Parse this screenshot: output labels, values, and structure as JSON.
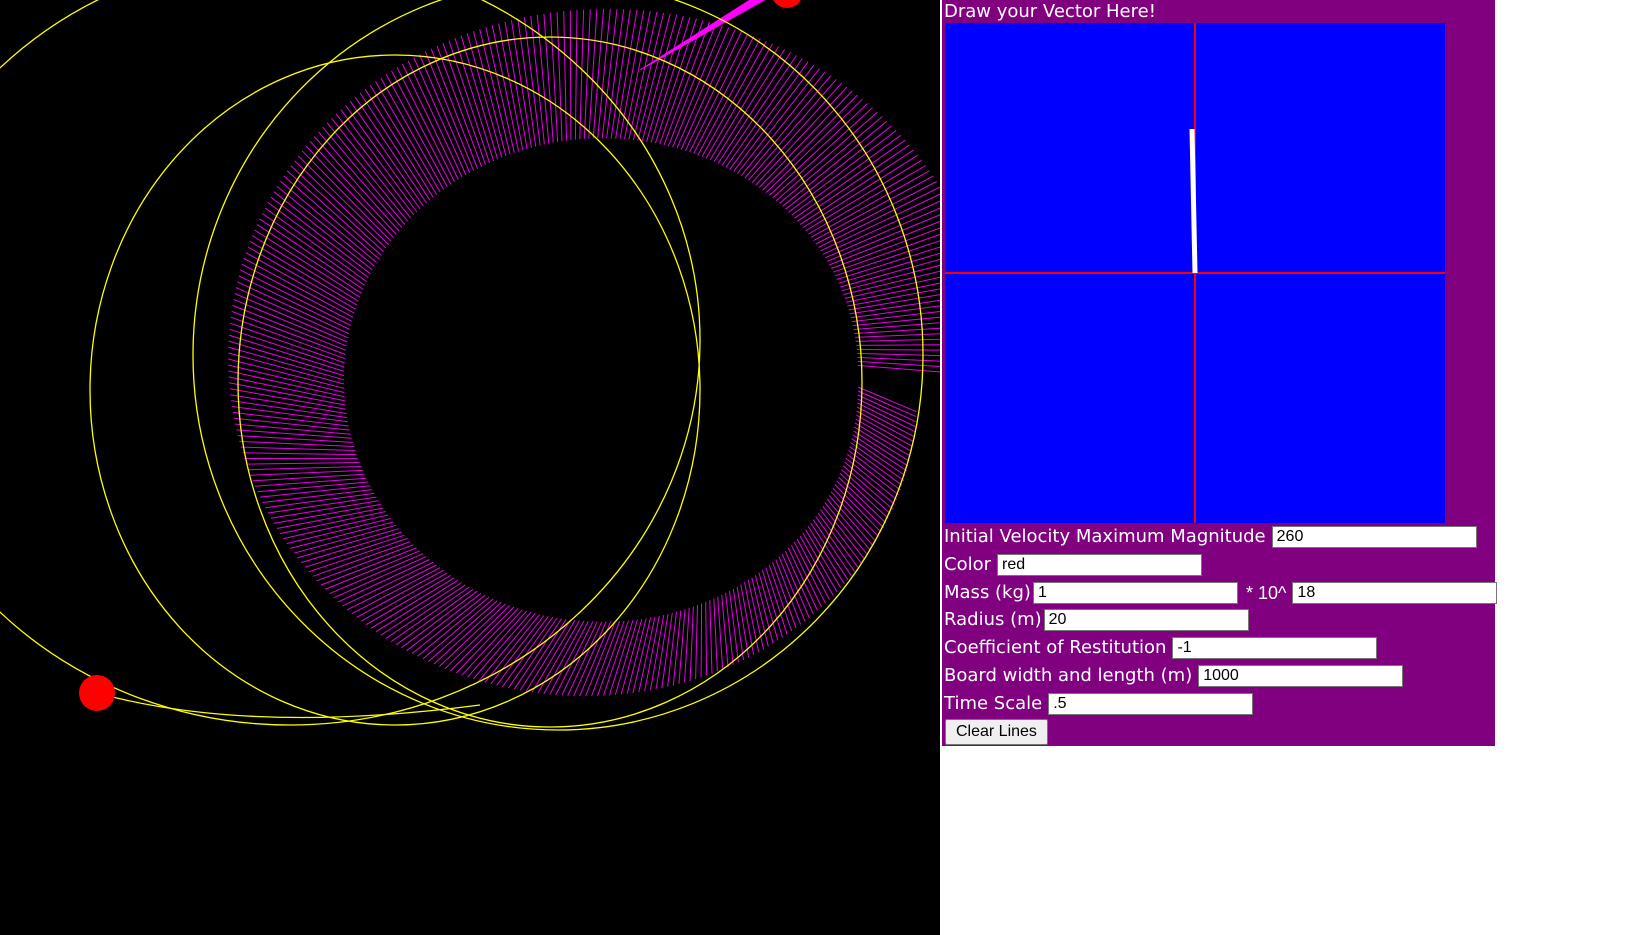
{
  "control_panel": {
    "title": "Draw your Vector Here!",
    "vector_pad": {
      "background_color": "#0000ff",
      "axis_color": "#ff0000",
      "vector_color": "#ffffff"
    },
    "fields": {
      "velocity": {
        "label": "Initial Velocity Maximum Magnitude",
        "value": "260"
      },
      "color": {
        "label": "Color",
        "value": "red"
      },
      "mass": {
        "label": "Mass (kg)",
        "value": "1",
        "times_label": "* 10^",
        "exponent_value": "18"
      },
      "radius": {
        "label": "Radius (m)",
        "value": "20"
      },
      "restitution": {
        "label": "Coefficient of Restitution",
        "value": "-1"
      },
      "board": {
        "label": "Board width and length (m)",
        "value": "1000"
      },
      "time_scale": {
        "label": "Time Scale",
        "value": ".5"
      }
    },
    "clear_button_label": "Clear Lines",
    "panel_color": "#800080"
  },
  "simulation": {
    "background_color": "#000000",
    "orbit_color": "#ffff00",
    "trail_color": "#ff00ff",
    "body_color": "#ff0000"
  }
}
